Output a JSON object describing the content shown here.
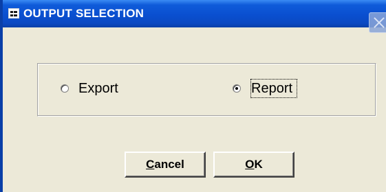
{
  "window": {
    "title": "OUTPUT SELECTION",
    "title_icon": "form-icon",
    "close_icon": "close-icon"
  },
  "output_options": {
    "items": [
      {
        "label": "Export",
        "selected": false
      },
      {
        "label": "Report",
        "selected": true
      }
    ]
  },
  "buttons": {
    "cancel": {
      "mnemonic": "C",
      "rest": "ancel"
    },
    "ok": {
      "mnemonic": "O",
      "rest": "K"
    }
  },
  "colors": {
    "titlebar": "#0a4fd0",
    "dialog_bg": "#ece9d8",
    "text": "#000000"
  }
}
